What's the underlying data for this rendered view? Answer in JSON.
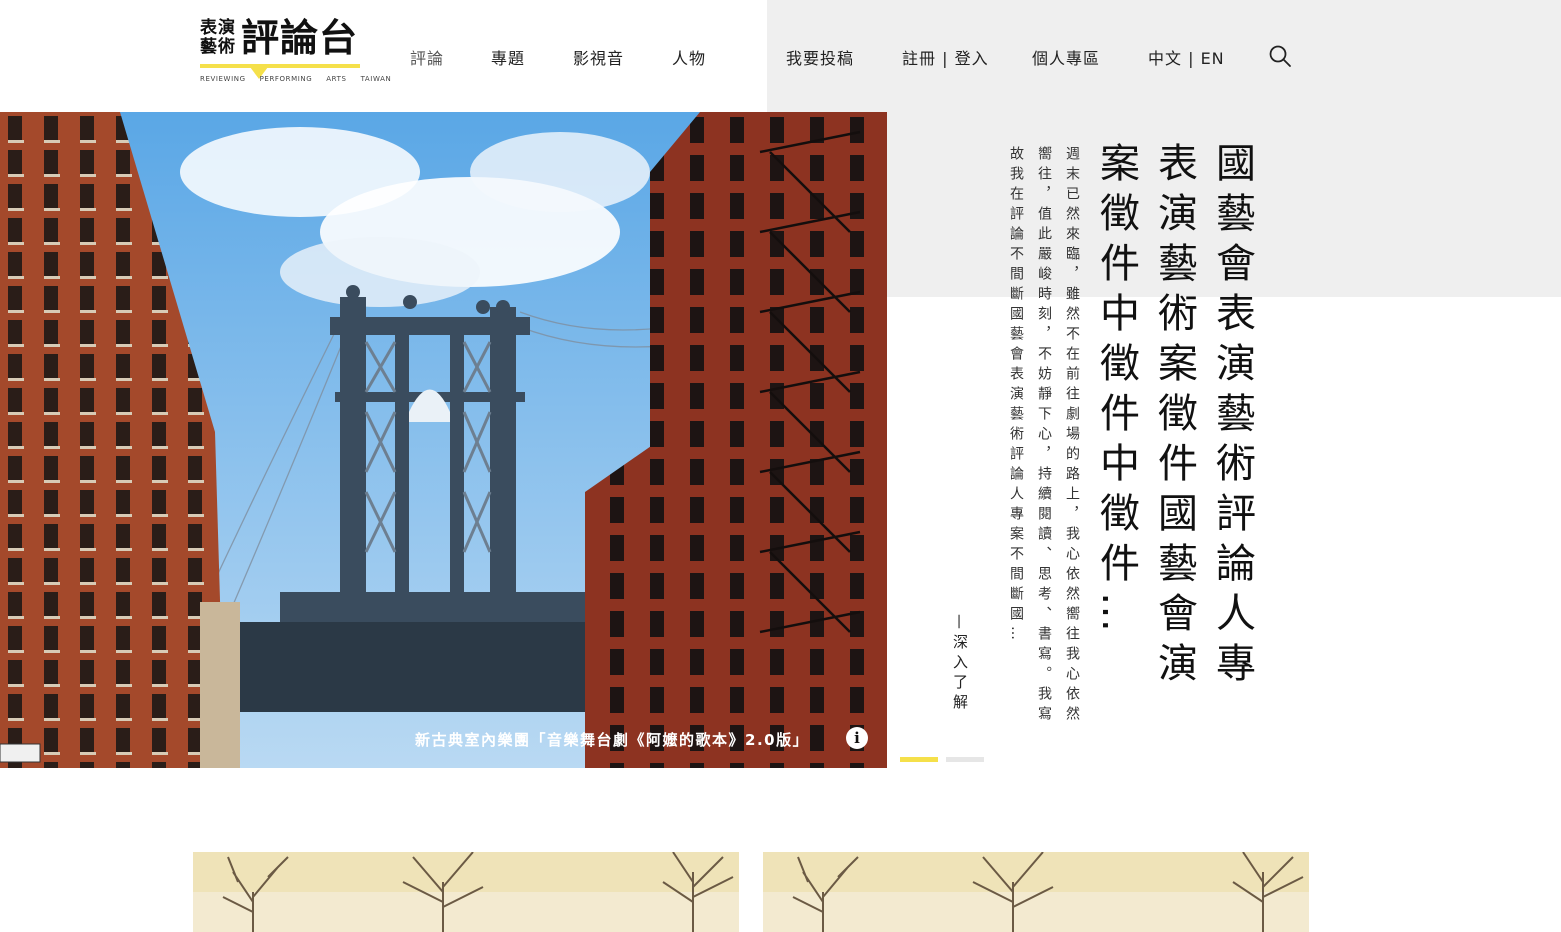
{
  "logo": {
    "line1": "表演",
    "line2": "藝術",
    "title": "評論台",
    "tagline": [
      "REVIEWING",
      "PERFORMING",
      "ARTS",
      "TAIWAN"
    ]
  },
  "nav": {
    "review": "評論",
    "topics": "專題",
    "media": "影視音",
    "people": "人物",
    "submit": "我要投稿",
    "auth": "註冊 | 登入",
    "account": "個人專區",
    "language": "中文 | EN"
  },
  "hero": {
    "caption": "新古典室內樂團「音樂舞台劇《阿嬤的歌本》2.0版」",
    "info_icon": "i",
    "title": "國藝會表演藝術評論人專表演藝術案徵件國藝會演案徵件中徵件中徵件…",
    "excerpt": "週末已然來臨，雖然不在前往劇場的路上，我心依然嚮往我心依然嚮往，值此嚴峻時刻，不妨靜下心，持續閱讀、思考、書寫。我寫故我在評論不間斷國藝會表演藝術評論人專案不間斷國…",
    "read_more": "—深入了解",
    "slides": 2,
    "active_slide": 1
  },
  "colors": {
    "accent": "#f5e04a",
    "panel": "#efefef"
  }
}
